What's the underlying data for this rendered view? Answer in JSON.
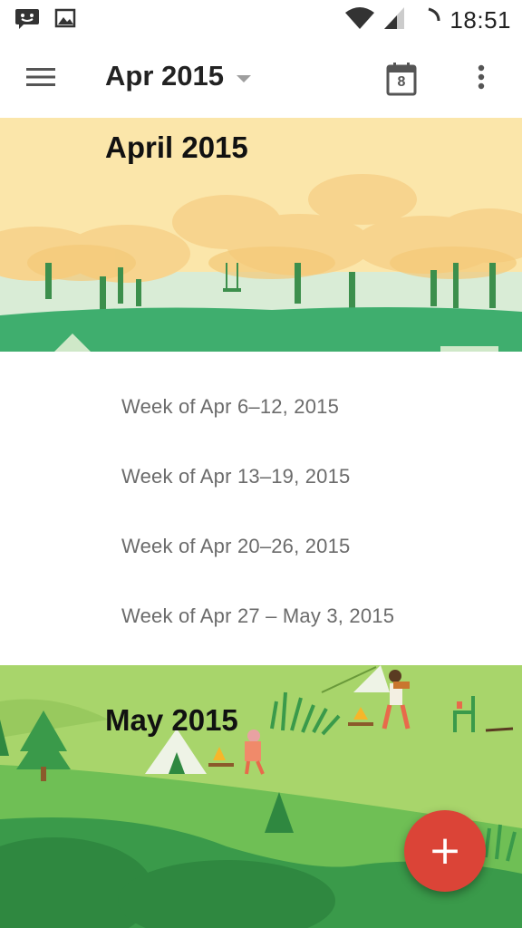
{
  "status_bar": {
    "time": "18:51",
    "icons": [
      "message-icon",
      "image-icon",
      "wifi-icon",
      "signal-icon",
      "sync-icon"
    ]
  },
  "app_bar": {
    "title": "Apr 2015",
    "today_icon_date": "8",
    "icons": [
      "menu-icon",
      "dropdown-caret-icon",
      "calendar-today-icon",
      "more-vert-icon"
    ]
  },
  "months": [
    {
      "title": "April 2015",
      "weeks": [
        "Week of Apr 6–12, 2015",
        "Week of Apr 13–19, 2015",
        "Week of Apr 20–26, 2015",
        "Week of Apr 27 – May 3, 2015"
      ]
    },
    {
      "title": "May 2015"
    }
  ],
  "fab": {
    "label": "+",
    "icon": "add-icon"
  },
  "colors": {
    "fab": "#db4437",
    "april_sky": "#fbe6aa",
    "april_grass": "#3fae6e",
    "may_grass": "#a8d56b",
    "may_dark_grass": "#3a9a4a",
    "week_text": "#6b6b6b"
  }
}
